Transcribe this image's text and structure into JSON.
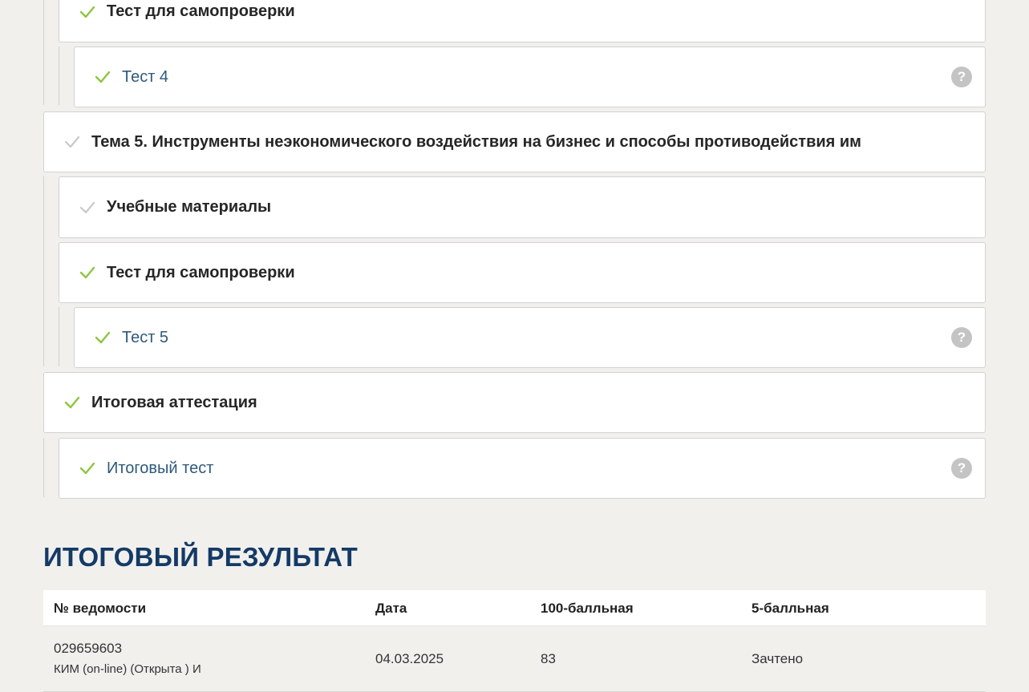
{
  "colors": {
    "check_green": "#8cc63f",
    "check_grey": "#c9c9c9",
    "link": "#2e5a7a",
    "heading": "#143a66"
  },
  "items": [
    {
      "title": "Тест для самопроверки",
      "status": "done",
      "icon": "check-icon"
    },
    {
      "title": "Тест 4",
      "status": "done",
      "icon": "check-icon",
      "help": "?"
    },
    {
      "title": "Тема 5. Инструменты неэкономического воздействия на бизнес и способы противодействия им",
      "status": "pending",
      "icon": "check-icon"
    },
    {
      "title": "Учебные материалы",
      "status": "pending",
      "icon": "check-icon"
    },
    {
      "title": "Тест для самопроверки",
      "status": "done",
      "icon": "check-icon"
    },
    {
      "title": "Тест 5",
      "status": "done",
      "icon": "check-icon",
      "help": "?"
    },
    {
      "title": "Итоговая аттестация",
      "status": "done",
      "icon": "check-icon"
    },
    {
      "title": "Итоговый тест",
      "status": "done",
      "icon": "check-icon",
      "help": "?"
    }
  ],
  "results": {
    "heading": "ИТОГОВЫЙ РЕЗУЛЬТАТ",
    "columns": [
      "№ ведомости",
      "Дата",
      "100-балльная",
      "5-балльная"
    ],
    "rows": [
      {
        "number": "029659603",
        "type": "КИМ (on-line) (Открыта ) И",
        "date": "04.03.2025",
        "score100": "83",
        "score5": "Зачтено"
      }
    ]
  }
}
